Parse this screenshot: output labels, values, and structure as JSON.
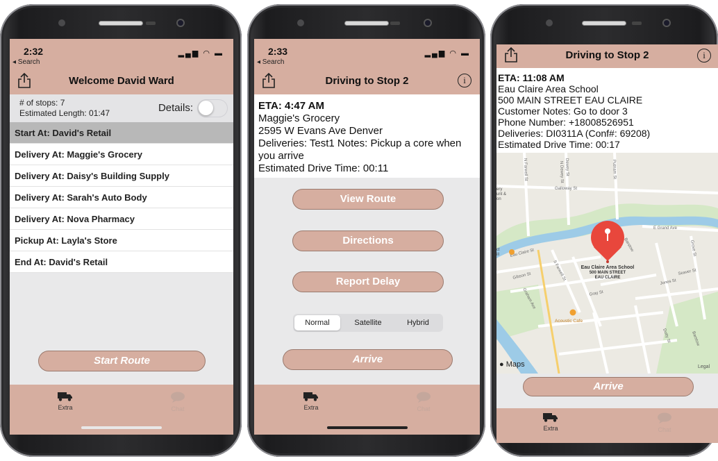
{
  "screen1": {
    "status": {
      "time": "2:32",
      "back": "◂ Search"
    },
    "nav_title": "Welcome David Ward",
    "summary": {
      "stops": "# of stops: 7",
      "length": "Estimated Length: 01:47",
      "details_label": "Details:",
      "details_on": false
    },
    "stops": [
      "Start At: David's Retail",
      "Delivery At: Maggie's Grocery",
      "Delivery At: Daisy's Building Supply",
      "Delivery At: Sarah's Auto Body",
      "Delivery At: Nova Pharmacy",
      "Pickup At: Layla's Store",
      "End At: David's Retail"
    ],
    "start_button": "Start Route",
    "tabs": {
      "extra": "Extra",
      "chat": "Chat"
    }
  },
  "screen2": {
    "status": {
      "time": "2:33",
      "back": "◂ Search"
    },
    "nav_title": "Driving to Stop 2",
    "eta": "ETA: 4:47 AM",
    "name": "Maggie's Grocery",
    "address": "2595 W Evans Ave  Denver",
    "deliveries": "Deliveries: Test1 Notes: Pickup a core when you arrive",
    "drive_time": "Estimated Drive Time: 00:11",
    "buttons": {
      "view_route": "View Route",
      "directions": "Directions",
      "report_delay": "Report Delay",
      "arrive": "Arrive"
    },
    "map_types": [
      "Normal",
      "Satellite",
      "Hybrid"
    ],
    "map_type_selected": "Normal",
    "tabs": {
      "extra": "Extra",
      "chat": "Chat"
    }
  },
  "screen3": {
    "nav_title": "Driving to Stop 2",
    "eta": "ETA: 11:08 AM",
    "name": "Eau Claire Area School",
    "address": "500 MAIN STREET  EAU CLAIRE",
    "notes": "Customer Notes: Go to door 3",
    "phone": "Phone Number: +18008526951",
    "deliveries": "Deliveries: DI0311A (Conf#: 69208)",
    "drive_time": "Estimated Drive Time: 00:17",
    "map": {
      "pin_title": "Eau Claire Area School",
      "pin_line2": "500 MAIN STREET",
      "pin_line3": "EAU CLAIRE",
      "poi": "Acoustic Cafe",
      "streets": [
        "Galloway St",
        "E Grand Ave",
        "Eau Claire St",
        "Gibson St",
        "S Farwell St",
        "Graham Ave",
        "Gray St",
        "Jones St",
        "Seaver St",
        "Dewey St",
        "Putnam St",
        "N Farwell St",
        "N Dewey St",
        "Grove St",
        "Dotty St",
        "Barstow"
      ],
      "edge_labels": [
        "ery",
        "unt &",
        "on",
        "ct",
        "ill"
      ],
      "brand": "Maps",
      "legal": "Legal"
    },
    "arrive": "Arrive",
    "tabs": {
      "extra": "Extra",
      "chat": "Chat"
    }
  },
  "colors": {
    "accent": "#d6aea0",
    "button_border": "#9a7a6e",
    "pin": "#e8473c"
  }
}
